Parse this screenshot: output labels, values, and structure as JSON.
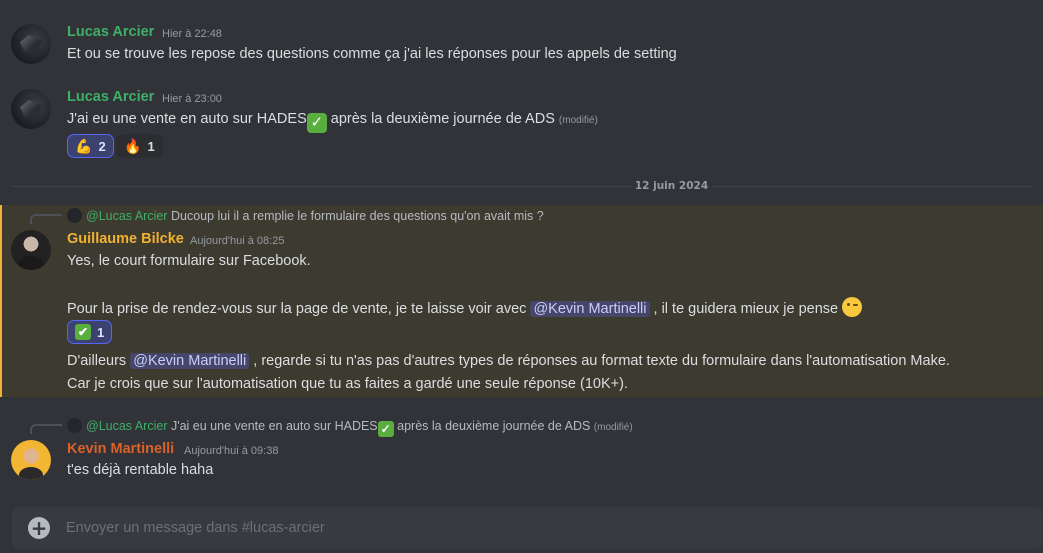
{
  "colors": {
    "background": "#313338",
    "lucas_name": "#3fae68",
    "guillaume_name": "#f0b232",
    "kevin_name": "#d9622a",
    "mention_bg": "#5865f2",
    "highlight_bg": "#3d3a2f"
  },
  "messages": [
    {
      "author": "Lucas Arcier",
      "timestamp": "Hier à 22:48",
      "text": "Et ou se trouve les repose des questions comme ça j'ai les réponses pour les appels de setting"
    },
    {
      "author": "Lucas Arcier",
      "timestamp": "Hier à 23:00",
      "text_before": "J'ai eu une vente en auto sur HADES",
      "text_after": " après la deuxième journée de ADS ",
      "edited": "(modifié)",
      "reactions": [
        {
          "emoji": "💪",
          "count": "2",
          "active": true
        },
        {
          "emoji": "🔥",
          "count": "1",
          "active": false
        }
      ]
    }
  ],
  "date_divider": "12 juin 2024",
  "guillaume_message": {
    "reply_to": "@Lucas Arcier",
    "reply_text": "Ducoup lui il a remplie le formulaire des questions qu'on avait mis ?",
    "author": "Guillaume Bilcke",
    "timestamp": "Aujourd'hui à 08:25",
    "line1": "Yes, le court formulaire sur Facebook.",
    "line2_before": "Pour la prise de rendez-vous sur la page de vente, je te laisse voir avec ",
    "mention": "@Kevin Martinelli",
    "line2_after": " , il te guidera mieux je pense",
    "reaction": {
      "emoji": "✔",
      "count": "1",
      "active": true
    },
    "line3_before": "D'ailleurs ",
    "line3_after": " , regarde si tu n'as pas d'autres types de réponses au format texte du formulaire dans l'automatisation Make.",
    "line4": "Car je crois que sur l'automatisation que tu as faites a gardé une seule réponse (10K+)."
  },
  "kevin_message": {
    "reply_to": "@Lucas Arcier",
    "reply_text_before": "J'ai eu une vente en auto sur HADES",
    "reply_text_after": " après la deuxième journée de ADS ",
    "reply_edited": "(modifié)",
    "author": "Kevin Martinelli",
    "timestamp": "Aujourd'hui à 09:38",
    "text": "t'es déjà rentable haha"
  },
  "composer": {
    "placeholder": "Envoyer un message dans #lucas-arcier"
  }
}
